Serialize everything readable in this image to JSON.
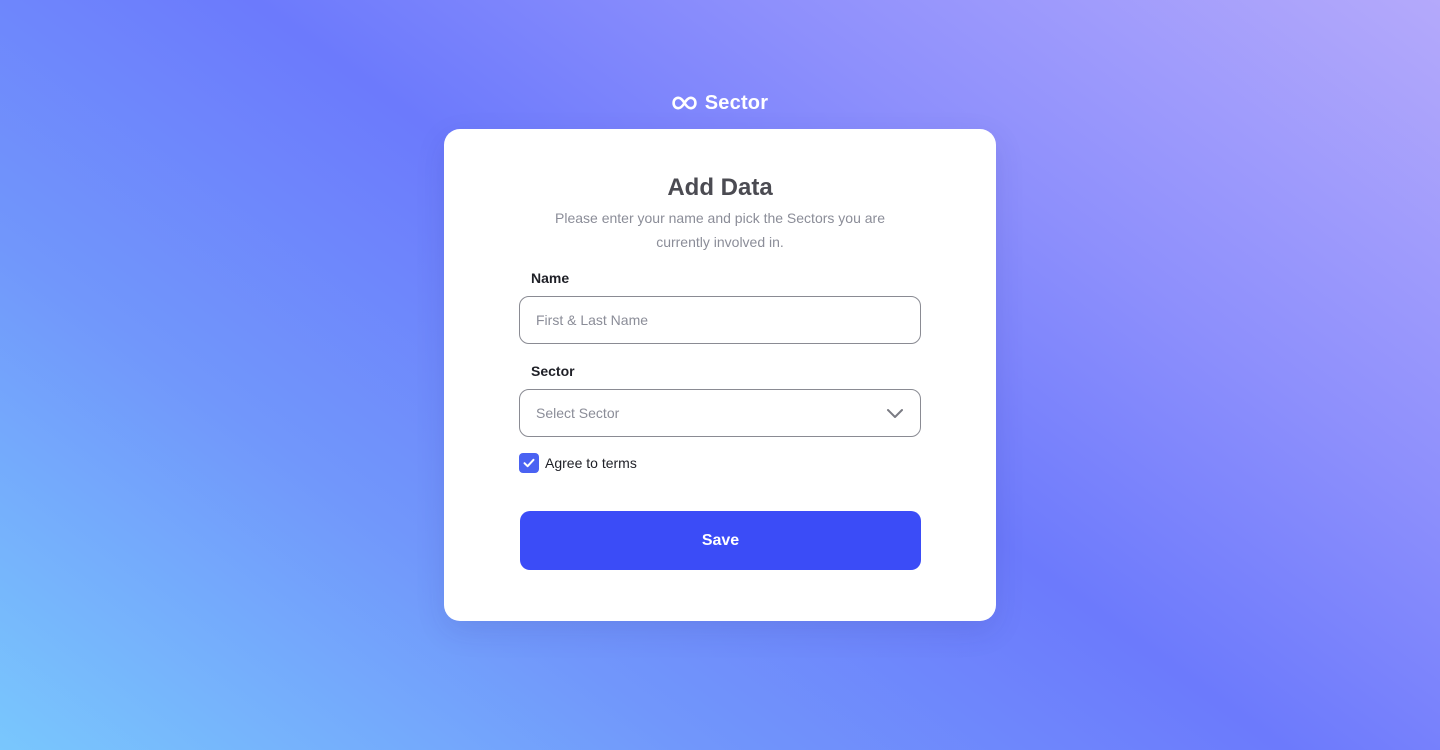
{
  "brand": {
    "name": "Sector",
    "icon": "infinity-icon"
  },
  "form": {
    "title": "Add Data",
    "subtitle": "Please enter your name and pick the Sectors you are currently involved in.",
    "name_field": {
      "label": "Name",
      "value": "",
      "placeholder": "First & Last Name"
    },
    "sector_field": {
      "label": "Sector",
      "selected": "Select Sector",
      "icon": "chevron-down-icon"
    },
    "terms": {
      "label": "Agree to terms",
      "checked": true,
      "icon": "checkmark-icon"
    },
    "save_label": "Save"
  },
  "colors": {
    "accent": "#3b4cf7",
    "checkbox": "#4a62f2",
    "title_text": "#4b4b52",
    "muted_text": "#8b8d98",
    "gradient_top_right": "#b4a9fb",
    "gradient_center": "#6c7afc",
    "gradient_bottom_left": "#79c7fd"
  }
}
